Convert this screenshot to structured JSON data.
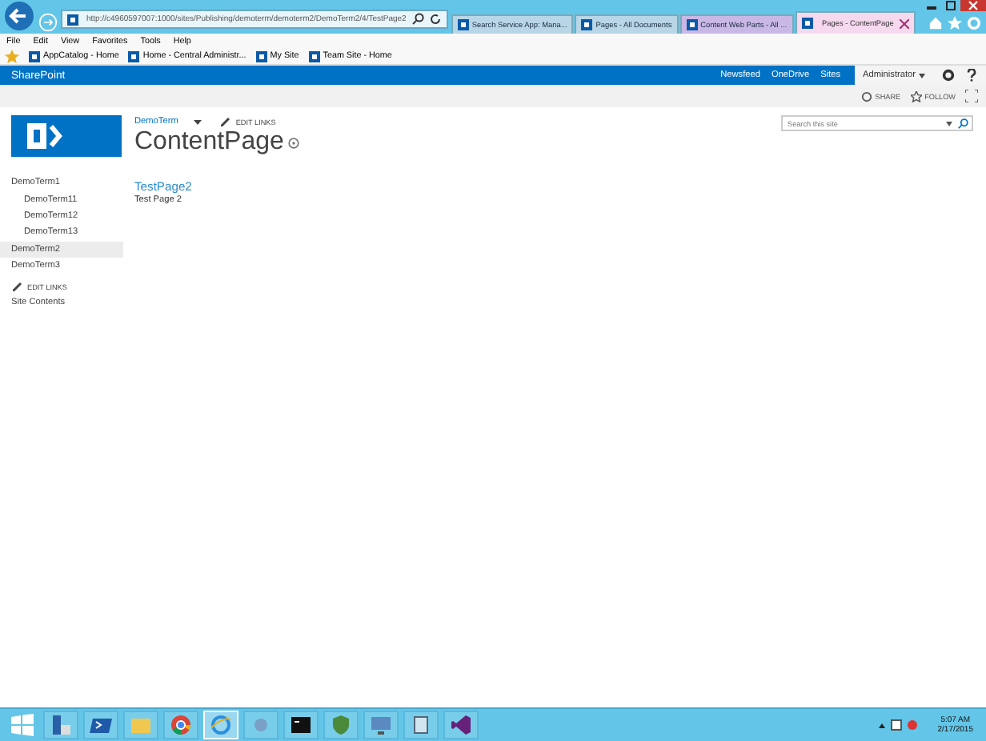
{
  "browser": {
    "address": "http://c4960597007:1000/sites/Publishing/demoterm/demoterm2/DemoTerm2/4/TestPage2",
    "tabs": [
      {
        "label": "Search Service App: Mana...",
        "selected": false,
        "color": "#b8d6e6"
      },
      {
        "label": "Pages - All Documents",
        "selected": false,
        "color": "#b8d6e6"
      },
      {
        "label": "Content Web Parts - All ...",
        "selected": false,
        "color": "#c9b8e6"
      },
      {
        "label": "Pages - ContentPage",
        "selected": true,
        "color": "#f6d8ef"
      }
    ],
    "menu": [
      "File",
      "Edit",
      "View",
      "Favorites",
      "Tools",
      "Help"
    ],
    "favorites": [
      "AppCatalog - Home",
      "Home - Central Administr...",
      "My Site",
      "Team Site - Home"
    ]
  },
  "suite_bar": {
    "brand": "SharePoint",
    "links": [
      "Newsfeed",
      "OneDrive",
      "Sites"
    ],
    "user": "Administrator"
  },
  "ribbon": {
    "actions": [
      "SHARE",
      "FOLLOW"
    ]
  },
  "top_nav": {
    "item": "DemoTerm",
    "edit_links": "EDIT LINKS"
  },
  "page_title": "ContentPage",
  "search": {
    "placeholder": "Search this site"
  },
  "nav": [
    {
      "label": "DemoTerm1",
      "selected": false,
      "children": [
        {
          "label": "DemoTerm11",
          "selected": false
        },
        {
          "label": "DemoTerm12",
          "selected": false
        },
        {
          "label": "DemoTerm13",
          "selected": false
        }
      ]
    },
    {
      "label": "DemoTerm2",
      "selected": true
    },
    {
      "label": "DemoTerm3",
      "selected": false
    }
  ],
  "nav_edit_links": "EDIT LINKS",
  "site_contents": "Site Contents",
  "content": {
    "heading": "TestPage2",
    "text": "Test Page 2"
  },
  "taskbar": {
    "time": "5:07 AM",
    "date": "2/17/2015"
  }
}
